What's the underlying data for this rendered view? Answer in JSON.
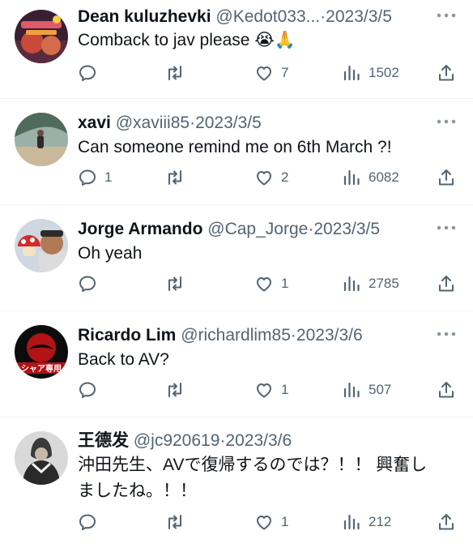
{
  "tweets": [
    {
      "name": "Dean kuluzhevki",
      "handle": "@Kedot033...",
      "separator": "·",
      "date": "2023/3/5",
      "text": "Comback to jav please 😭🙏",
      "replies": "",
      "retweets": "",
      "likes": "7",
      "views": "1502"
    },
    {
      "name": "xavi",
      "handle": "@xaviii85",
      "separator": "·",
      "date": "2023/3/5",
      "text": "Can someone remind me on 6th March ?!",
      "replies": "1",
      "retweets": "",
      "likes": "2",
      "views": "6082"
    },
    {
      "name": "Jorge Armando",
      "handle": "@Cap_Jorge",
      "separator": "·",
      "date": "2023/3/5",
      "text": "Oh yeah",
      "replies": "",
      "retweets": "",
      "likes": "1",
      "views": "2785"
    },
    {
      "name": "Ricardo Lim",
      "handle": "@richardlim85",
      "separator": "·",
      "date": "2023/3/6",
      "text": "Back to AV?",
      "avatar_text": "シャア専用",
      "replies": "",
      "retweets": "",
      "likes": "1",
      "views": "507"
    },
    {
      "name": "王德发",
      "handle": "@jc920619",
      "separator": "·",
      "date": "2023/3/6",
      "text_line1": "沖田先生、AVで復帰するのでは？！！ 興奮し",
      "text_line2": "ましたね。！！",
      "replies": "",
      "retweets": "",
      "likes": "1",
      "views": "212"
    }
  ],
  "icons": {
    "reply": "reply-icon",
    "retweet": "retweet-icon",
    "like": "heart-icon",
    "views": "views-icon",
    "share": "share-icon",
    "more": "more-icon"
  },
  "colors": {
    "text": "#0f1419",
    "secondary": "#536471",
    "divider": "#eff3f4"
  }
}
